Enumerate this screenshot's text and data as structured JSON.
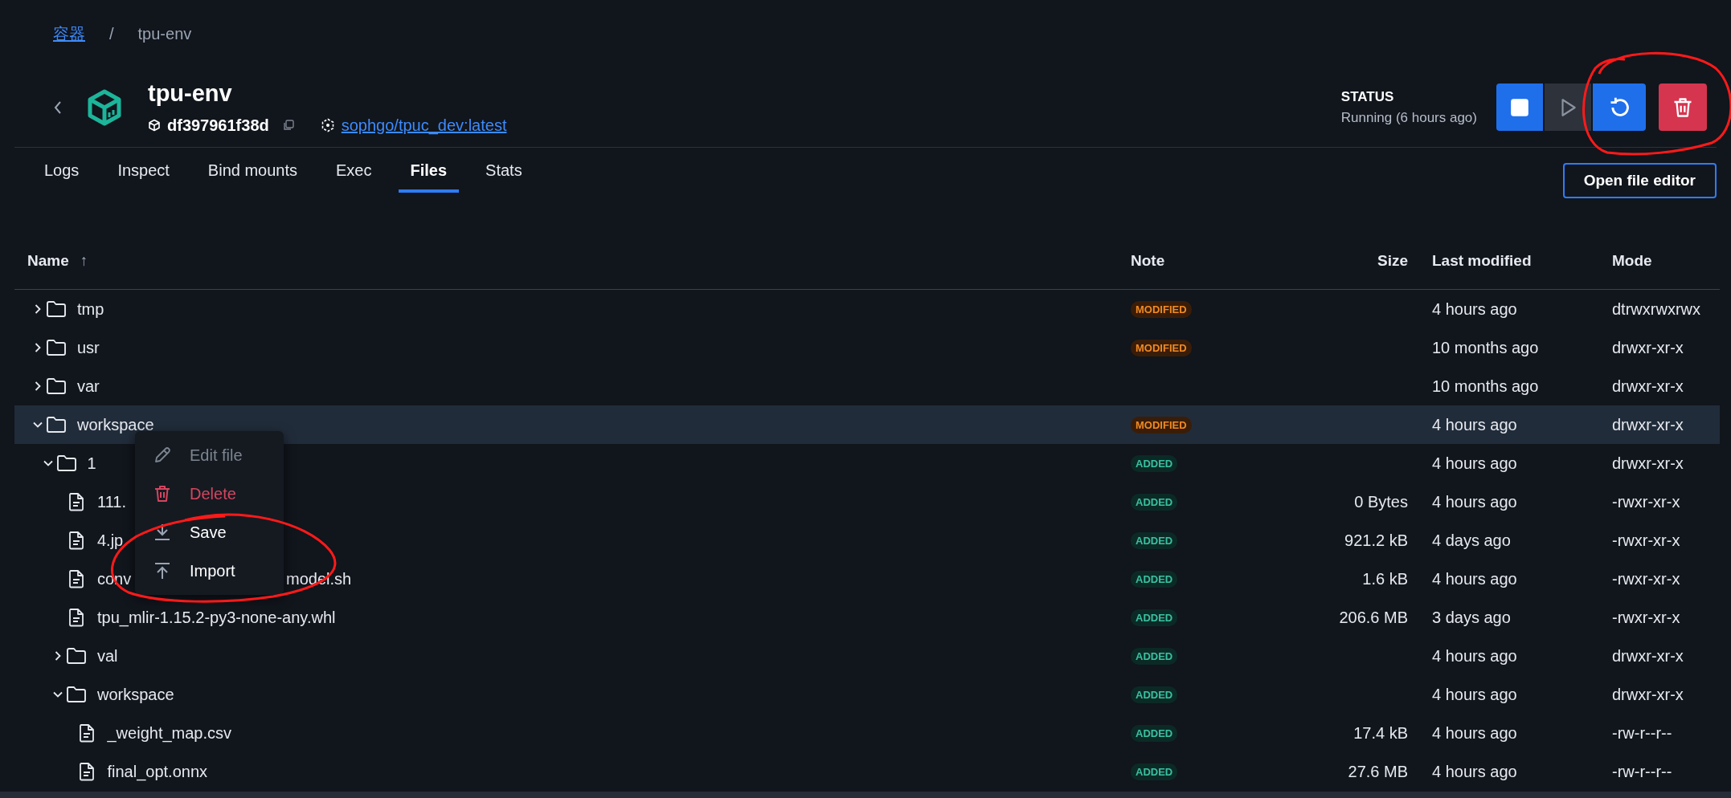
{
  "breadcrumb": [
    {
      "kind": "link",
      "label": "容器"
    },
    {
      "kind": "current",
      "label": "tpu-env"
    }
  ],
  "breadcrumb_separator": "/",
  "container": {
    "name": "tpu-env",
    "id": "df397961f38d",
    "image": "sophgo/tpuc_dev:latest"
  },
  "status": {
    "label": "STATUS",
    "text": "Running (6 hours ago)"
  },
  "actions": [
    {
      "kind": "stop",
      "disabled": false
    },
    {
      "kind": "start",
      "disabled": true
    },
    {
      "kind": "restart",
      "disabled": false
    },
    {
      "kind": "delete",
      "disabled": false
    }
  ],
  "tabs": [
    {
      "label": "Logs",
      "selected": false
    },
    {
      "label": "Inspect",
      "selected": false
    },
    {
      "label": "Bind mounts",
      "selected": false
    },
    {
      "label": "Exec",
      "selected": false
    },
    {
      "label": "Files",
      "selected": true
    },
    {
      "label": "Stats",
      "selected": false
    }
  ],
  "open_editor_button": "Open file editor",
  "table": {
    "columns": [
      {
        "label": "Name",
        "sort_indicator": "↑"
      },
      {
        "label": "Note"
      },
      {
        "label": "Size"
      },
      {
        "label": "Last modified"
      },
      {
        "label": "Mode"
      }
    ],
    "rows": [
      {
        "kind": "folder",
        "name": "tmp",
        "expanded": false,
        "selected": false,
        "note": {
          "kind": "modified",
          "text": "MODIFIED"
        },
        "modified": "4 hours ago",
        "mode": "dtrwxrwxrwx"
      },
      {
        "kind": "folder",
        "name": "usr",
        "expanded": false,
        "selected": false,
        "note": {
          "kind": "modified",
          "text": "MODIFIED"
        },
        "modified": "10 months ago",
        "mode": "drwxr-xr-x"
      },
      {
        "kind": "folder",
        "name": "var",
        "expanded": false,
        "selected": false,
        "modified": "10 months ago",
        "mode": "drwxr-xr-x"
      },
      {
        "kind": "folder",
        "name": "workspace",
        "expanded": true,
        "selected": true,
        "note": {
          "kind": "modified",
          "text": "MODIFIED"
        },
        "modified": "4 hours ago",
        "mode": "drwxr-xr-x",
        "children": [
          {
            "kind": "folder",
            "name": "1",
            "expanded": true,
            "selected": false,
            "note": {
              "kind": "added",
              "text": "ADDED"
            },
            "modified": "4 hours ago",
            "mode": "drwxr-xr-x",
            "children": [
              {
                "kind": "file",
                "name": "111.",
                "selected": false,
                "note": {
                  "kind": "added",
                  "text": "ADDED"
                },
                "size": "0 Bytes",
                "modified": "4 hours ago",
                "mode": "-rwxr-xr-x"
              },
              {
                "kind": "file",
                "name": "4.jp",
                "selected": false,
                "note": {
                  "kind": "added",
                  "text": "ADDED"
                },
                "size": "921.2 kB",
                "modified": "4 days ago",
                "mode": "-rwxr-xr-x"
              },
              {
                "kind": "file",
                "name": "conv",
                "name_after_menu": "model.sh",
                "selected": false,
                "note": {
                  "kind": "added",
                  "text": "ADDED"
                },
                "size": "1.6 kB",
                "modified": "4 hours ago",
                "mode": "-rwxr-xr-x"
              },
              {
                "kind": "file",
                "name": "tpu_mlir-1.15.2-py3-none-any.whl",
                "selected": false,
                "note": {
                  "kind": "added",
                  "text": "ADDED"
                },
                "size": "206.6 MB",
                "modified": "3 days ago",
                "mode": "-rwxr-xr-x"
              },
              {
                "kind": "folder",
                "name": "val",
                "expanded": false,
                "selected": false,
                "note": {
                  "kind": "added",
                  "text": "ADDED"
                },
                "modified": "4 hours ago",
                "mode": "drwxr-xr-x"
              },
              {
                "kind": "folder",
                "name": "workspace",
                "expanded": true,
                "selected": false,
                "note": {
                  "kind": "added",
                  "text": "ADDED"
                },
                "modified": "4 hours ago",
                "mode": "drwxr-xr-x",
                "children": [
                  {
                    "kind": "file",
                    "name": "_weight_map.csv",
                    "selected": false,
                    "note": {
                      "kind": "added",
                      "text": "ADDED"
                    },
                    "size": "17.4 kB",
                    "modified": "4 hours ago",
                    "mode": "-rw-r--r--"
                  },
                  {
                    "kind": "file",
                    "name": "final_opt.onnx",
                    "selected": false,
                    "note": {
                      "kind": "added",
                      "text": "ADDED"
                    },
                    "size": "27.6 MB",
                    "modified": "4 hours ago",
                    "mode": "-rw-r--r--"
                  }
                ]
              }
            ]
          }
        ]
      }
    ]
  },
  "context_menu": {
    "items": [
      {
        "kind": "edit",
        "label": "Edit file",
        "disabled": true
      },
      {
        "kind": "delete",
        "label": "Delete",
        "disabled": false
      },
      {
        "kind": "save",
        "label": "Save",
        "disabled": false
      },
      {
        "kind": "import",
        "label": "Import",
        "disabled": false
      }
    ]
  }
}
